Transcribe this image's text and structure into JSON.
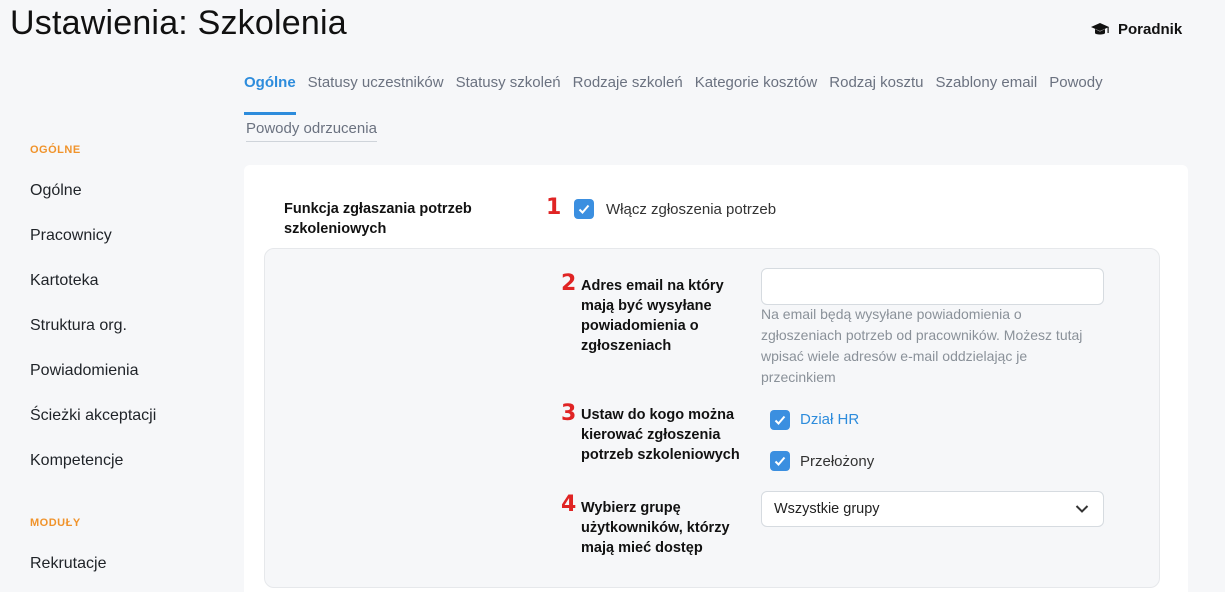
{
  "page": {
    "title": "Ustawienia: Szkolenia"
  },
  "guide": {
    "label": "Poradnik",
    "icon": "graduation-cap-icon"
  },
  "tabs": [
    {
      "label": "Ogólne",
      "active": true
    },
    {
      "label": "Statusy uczestników",
      "active": false
    },
    {
      "label": "Statusy szkoleń",
      "active": false
    },
    {
      "label": "Rodzaje szkoleń",
      "active": false
    },
    {
      "label": "Kategorie kosztów",
      "active": false
    },
    {
      "label": "Rodzaj kosztu",
      "active": false
    },
    {
      "label": "Szablony email",
      "active": false
    },
    {
      "label": "Powody",
      "active": false
    },
    {
      "label": "Powody odrzucenia",
      "active": false
    }
  ],
  "sidebar": {
    "section1": "OGÓLNE",
    "items1": [
      "Ogólne",
      "Pracownicy",
      "Kartoteka",
      "Struktura org.",
      "Powiadomienia",
      "Ścieżki akceptacji",
      "Kompetencje"
    ],
    "section2": "MODUŁY",
    "items2": [
      "Rekrutacje"
    ]
  },
  "form": {
    "feature": {
      "label": "Funkcja zgłaszania potrzeb szkoleniowych",
      "marker": "1",
      "checkbox_label": "Włącz zgłoszenia potrzeb",
      "checked": true
    },
    "email": {
      "marker": "2",
      "label": "Adres email na który mają być wysyłane powiadomienia o zgłoszeniach",
      "value": "",
      "placeholder": "",
      "help": "Na email będą wysyłane powiadomienia o zgłoszeniach potrzeb od pracowników. Możesz tutaj wpisać wiele adresów e-mail oddzielając je przecinkiem"
    },
    "recipients": {
      "marker": "3",
      "label": "Ustaw do kogo można kierować zgłoszenia potrzeb szkoleniowych",
      "options": [
        {
          "label": "Dział HR",
          "checked": true
        },
        {
          "label": "Przełożony",
          "checked": true
        }
      ]
    },
    "group": {
      "marker": "4",
      "label": "Wybierz grupę użytkowników, którzy mają mieć dostęp",
      "selected": "Wszystkie grupy"
    }
  },
  "colors": {
    "accent": "#2d8cdc",
    "checkbox": "#3b8fe0",
    "section": "#f0932b",
    "marker": "#e02424"
  }
}
